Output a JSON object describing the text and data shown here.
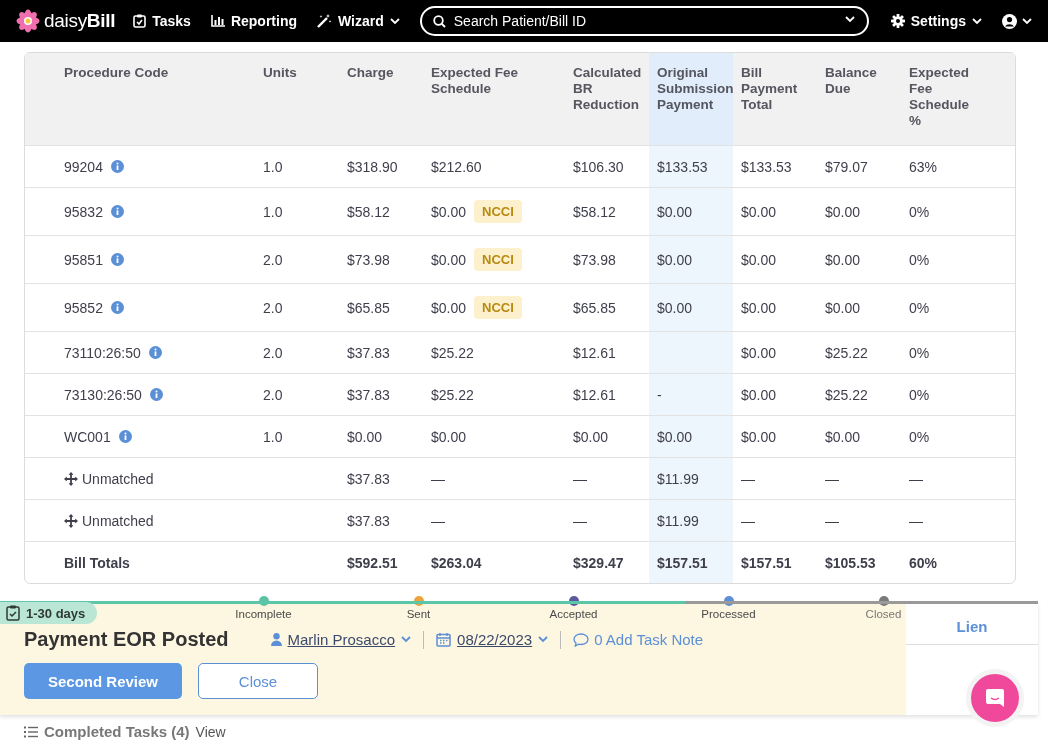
{
  "nav": {
    "logo": "daisy**Bill**",
    "items": [
      {
        "label": "Tasks",
        "dropdown": false
      },
      {
        "label": "Reporting",
        "dropdown": false
      },
      {
        "label": "Wizard",
        "dropdown": true
      }
    ],
    "search": {
      "placeholder": "Search Patient/Bill ID"
    },
    "settings": {
      "label": "Settings"
    }
  },
  "table": {
    "columns": [
      {
        "label": "Procedure Code",
        "highlighted": false
      },
      {
        "label": "Units",
        "highlighted": false
      },
      {
        "label": "Charge",
        "highlighted": false
      },
      {
        "label": "Expected Fee Schedule",
        "highlighted": false
      },
      {
        "label": "Calculated BR Reduction",
        "highlighted": false
      },
      {
        "label": "Original Submission Payment",
        "highlighted": true
      },
      {
        "label": "Bill Payment Total",
        "highlighted": false
      },
      {
        "label": "Balance Due",
        "highlighted": false
      },
      {
        "label": "Expected Fee Schedule %",
        "highlighted": false
      }
    ],
    "rows": [
      {
        "kind": "code",
        "code": "99204",
        "units": "1.0",
        "charge": "$318.90",
        "expected_fee": "$212.60",
        "calculated_br_reduction": "$106.30",
        "original_submission_payment": "$133.53",
        "bill_payment_total": "$133.53",
        "balance_due": "$79.07",
        "expected_fee_pct": "63%"
      },
      {
        "kind": "code",
        "code": "95832",
        "units": "1.0",
        "charge": "$58.12",
        "expected_fee": "$0.00",
        "badge": "NCCI",
        "calculated_br_reduction": "$58.12",
        "original_submission_payment": "$0.00",
        "bill_payment_total": "$0.00",
        "balance_due": "$0.00",
        "expected_fee_pct": "0%"
      },
      {
        "kind": "code",
        "code": "95851",
        "units": "2.0",
        "charge": "$73.98",
        "expected_fee": "$0.00",
        "badge": "NCCI",
        "calculated_br_reduction": "$73.98",
        "original_submission_payment": "$0.00",
        "bill_payment_total": "$0.00",
        "balance_due": "$0.00",
        "expected_fee_pct": "0%"
      },
      {
        "kind": "code",
        "code": "95852",
        "units": "2.0",
        "charge": "$65.85",
        "expected_fee": "$0.00",
        "badge": "NCCI",
        "calculated_br_reduction": "$65.85",
        "original_submission_payment": "$0.00",
        "bill_payment_total": "$0.00",
        "balance_due": "$0.00",
        "expected_fee_pct": "0%"
      },
      {
        "kind": "code",
        "code": "73110:26:50",
        "units": "2.0",
        "charge": "$37.83",
        "expected_fee": "$25.22",
        "calculated_br_reduction": "$12.61",
        "bill_payment_total": "$0.00",
        "balance_due": "$25.22",
        "expected_fee_pct": "0%"
      },
      {
        "kind": "code",
        "code": "73130:26:50",
        "units": "2.0",
        "charge": "$37.83",
        "expected_fee": "$25.22",
        "calculated_br_reduction": "$12.61",
        "original_submission_payment": "-",
        "bill_payment_total": "$0.00",
        "balance_due": "$25.22",
        "expected_fee_pct": "0%"
      },
      {
        "kind": "code",
        "code": "WC001",
        "units": "1.0",
        "charge": "$0.00",
        "expected_fee": "$0.00",
        "calculated_br_reduction": "$0.00",
        "original_submission_payment": "$0.00",
        "bill_payment_total": "$0.00",
        "balance_due": "$0.00",
        "expected_fee_pct": "0%"
      },
      {
        "kind": "unmatched",
        "code": "Unmatched",
        "charge": "$37.83",
        "expected_fee": "—",
        "calculated_br_reduction": "—",
        "original_submission_payment": "$11.99",
        "bill_payment_total": "—",
        "balance_due": "—",
        "expected_fee_pct": "—"
      },
      {
        "kind": "unmatched",
        "code": "Unmatched",
        "charge": "$37.83",
        "expected_fee": "—",
        "calculated_br_reduction": "—",
        "original_submission_payment": "$11.99",
        "bill_payment_total": "—",
        "balance_due": "—",
        "expected_fee_pct": "—"
      },
      {
        "kind": "totals",
        "code": "Bill Totals",
        "charge": "$592.51",
        "expected_fee": "$263.04",
        "calculated_br_reduction": "$329.47",
        "original_submission_payment": "$157.51",
        "bill_payment_total": "$157.51",
        "balance_due": "$105.53",
        "expected_fee_pct": "60%"
      }
    ]
  },
  "task": {
    "age_tag": "1-30 days",
    "progress": {
      "level": 0.66
    },
    "steps": [
      {
        "label": "Incomplete",
        "color": "#5bc2a3"
      },
      {
        "label": "Sent",
        "color": "#f0a23a"
      },
      {
        "label": "Accepted",
        "color": "#5b5a9e"
      },
      {
        "label": "Processed",
        "color": "#5d8fd8"
      },
      {
        "label": "Closed",
        "color": "#7a7a7a"
      }
    ],
    "title": "Payment EOR Posted",
    "assignee": "Marlin Prosacco",
    "date": "08/22/2023",
    "note_link": "0 Add Task Note",
    "buttons": [
      {
        "label": "Second Review",
        "kind": "primary"
      },
      {
        "label": "Close",
        "kind": "secondary"
      }
    ],
    "side_tab": "Lien"
  },
  "completed_tasks": {
    "label": "Completed Tasks (4)",
    "link": "View"
  }
}
